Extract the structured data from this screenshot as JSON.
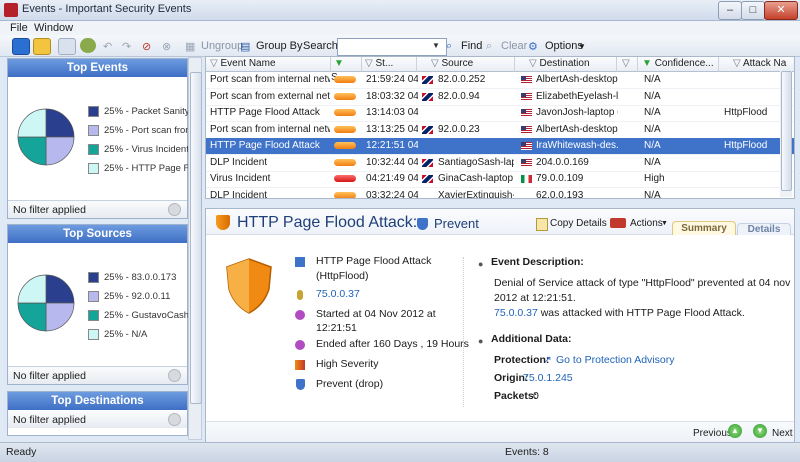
{
  "window": {
    "title": "Events - Important Security Events",
    "min": "–",
    "max": "□",
    "close": "✕"
  },
  "menu": [
    "File",
    "Window"
  ],
  "toolbar": {
    "ungroup": "Ungroup",
    "group_by": "Group By",
    "search_label": "Search:",
    "search_value": "",
    "find": "Find",
    "clear": "Clear",
    "options": "Options"
  },
  "top_events": {
    "title": "Top Events",
    "footer": "No filter applied",
    "legend": [
      {
        "label": "25% - Packet Sanity",
        "color": "#2b3f8f"
      },
      {
        "label": "25% - Port scan from",
        "color": "#b7b9ee"
      },
      {
        "label": "25% - Virus Incident",
        "color": "#14a49a"
      },
      {
        "label": "25% - HTTP Page Flo",
        "color": "#ccf7f5"
      }
    ]
  },
  "top_sources": {
    "title": "Top Sources",
    "footer": "No filter applied",
    "legend": [
      {
        "label": "25% - 83.0.0.173",
        "color": "#2b3f8f"
      },
      {
        "label": "25% - 92.0.0.11",
        "color": "#b7b9ee"
      },
      {
        "label": "25% - GustavoCash-l",
        "color": "#14a49a"
      },
      {
        "label": "25% - N/A",
        "color": "#ccf7f5"
      }
    ]
  },
  "top_destinations": {
    "title": "Top Destinations",
    "footer": "No filter applied"
  },
  "grid": {
    "columns": [
      "Event Name",
      "S...",
      "St...",
      "Source",
      "Destination",
      "Confidence...",
      "Attack Na"
    ],
    "rows": [
      {
        "event": "Port scan from internal network",
        "sev": "orange",
        "time": "21:59:24 04...",
        "src_flag": "uk",
        "source": "82.0.0.252",
        "dst_flag": "us",
        "destination": "AlbertAsh-desktop ...",
        "conf": "N/A",
        "attack": ""
      },
      {
        "event": "Port scan from external network",
        "sev": "orange",
        "time": "18:03:32 04...",
        "src_flag": "uk",
        "source": "82.0.0.94",
        "dst_flag": "us",
        "destination": "ElizabethEyelash-l...",
        "conf": "N/A",
        "attack": ""
      },
      {
        "event": "HTTP Page Flood Attack",
        "sev": "orange",
        "time": "13:14:03 04...",
        "src_flag": "",
        "source": "",
        "dst_flag": "us",
        "destination": "JavonJosh-laptop (...",
        "conf": "N/A",
        "attack": "HttpFlood"
      },
      {
        "event": "Port scan from internal network",
        "sev": "orange",
        "time": "13:13:25 04...",
        "src_flag": "uk",
        "source": "92.0.0.23",
        "dst_flag": "us",
        "destination": "AlbertAsh-desktop ...",
        "conf": "N/A",
        "attack": ""
      },
      {
        "event": "HTTP Page Flood Attack",
        "sev": "orange",
        "time": "12:21:51 04...",
        "src_flag": "",
        "source": "",
        "dst_flag": "us",
        "destination": "IraWhitewash-des...",
        "conf": "N/A",
        "attack": "HttpFlood",
        "selected": true
      },
      {
        "event": "DLP Incident",
        "sev": "orange",
        "time": "10:32:44 04...",
        "src_flag": "uk",
        "source": "SantiagoSash-lapt...",
        "dst_flag": "us",
        "destination": "204.0.0.169",
        "conf": "N/A",
        "attack": ""
      },
      {
        "event": "Virus Incident",
        "sev": "red",
        "time": "04:21:49 04...",
        "src_flag": "uk",
        "source": "GinaCash-laptop (8...",
        "dst_flag": "it",
        "destination": "79.0.0.109",
        "conf": "High",
        "attack": ""
      },
      {
        "event": "DLP Incident",
        "sev": "orange",
        "time": "03:32:24 04...",
        "src_flag": "",
        "source": "XavierExtinguish-d...",
        "dst_flag": "",
        "destination": "62.0.0.193",
        "conf": "N/A",
        "attack": ""
      }
    ]
  },
  "detail": {
    "title": "HTTP Page Flood Attack:",
    "action": "Prevent",
    "copy": "Copy Details",
    "actions": "Actions",
    "tab_summary": "Summary",
    "tab_details": "Details",
    "name_l1": "HTTP Page Flood Attack",
    "name_l2": "(HttpFlood)",
    "ip": "75.0.0.37",
    "started_l1": "Started at 04 Nov 2012 at",
    "started_l2": "12:21:51",
    "ended": "Ended after 160 Days , 19 Hours",
    "severity": "High Severity",
    "prevent": "Prevent (drop)",
    "desc_title": "Event Description:",
    "desc_l1": "Denial of Service attack of type \"HttpFlood\" prevented at 04 nov",
    "desc_l2": "2012 at 12:21:51.",
    "desc_ip": "75.0.0.37",
    "desc_l3": " was attacked with HTTP Page Flood Attack.",
    "add_title": "Additional Data:",
    "prot_label": "Protection:",
    "prot_link": "Go to Protection Advisory",
    "origin_label": "Origin:",
    "origin_val": "75.0.1.245",
    "packets_label": "Packets:",
    "packets_val": "0",
    "prev": "Previous",
    "next": "Next"
  },
  "status": {
    "left": "Ready",
    "events": "Events: 8"
  }
}
